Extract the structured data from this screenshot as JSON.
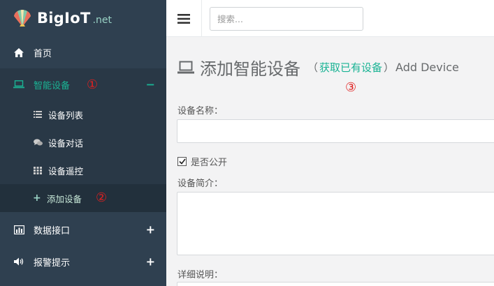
{
  "brand": {
    "name": "BigIoT",
    "suffix": ".net"
  },
  "sidebar": {
    "items": [
      {
        "label": "首页",
        "icon": "home-icon"
      },
      {
        "label": "智能设备",
        "icon": "laptop-icon",
        "sign": "−",
        "annotation": "①"
      },
      {
        "label": "数据接口",
        "icon": "bar-chart-icon",
        "sign": "+"
      },
      {
        "label": "报警提示",
        "icon": "volume-icon",
        "sign": "+"
      }
    ],
    "submenu": [
      {
        "label": "设备列表",
        "icon": "list-icon"
      },
      {
        "label": "设备对话",
        "icon": "comments-icon"
      },
      {
        "label": "设备遥控",
        "icon": "grid-icon"
      },
      {
        "label": "添加设备",
        "icon": "plus-icon",
        "annotation": "②"
      }
    ]
  },
  "topbar": {
    "search_placeholder": "搜索..."
  },
  "main": {
    "title": "添加智能设备",
    "paren_open": "（",
    "link": "获取已有设备",
    "paren_close": "）",
    "title_en": "Add Device",
    "annotation": "③",
    "form": {
      "name_label": "设备名称：",
      "public_label": "是否公开",
      "public_checked": true,
      "intro_label": "设备简介：",
      "detail_label": "详细说明："
    }
  },
  "colors": {
    "sidebar": "#2f4050",
    "accent": "#1ab394",
    "annotation": "#e02020"
  }
}
